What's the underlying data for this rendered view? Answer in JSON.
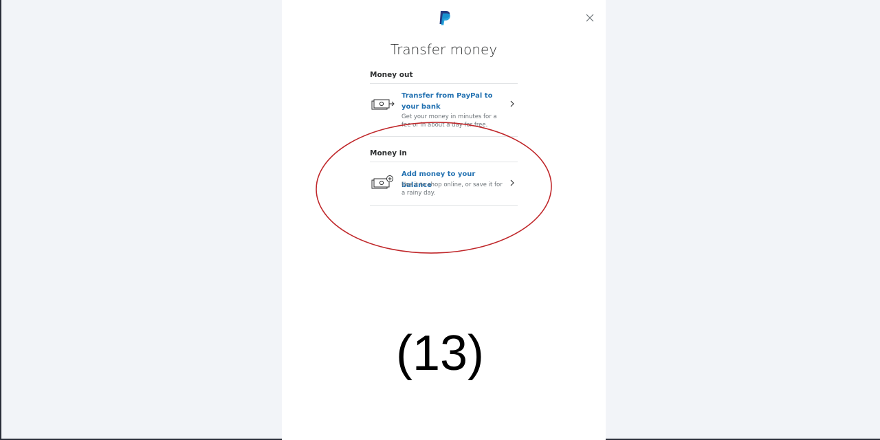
{
  "modal": {
    "title": "Transfer money",
    "logo_icon": "paypal-logo",
    "close_icon": "close-icon"
  },
  "money_out": {
    "label": "Money out",
    "option": {
      "icon": "bank-transfer-icon",
      "title": "Transfer from PayPal to your bank",
      "description": "Get your money in minutes for a fee or in about a day for free."
    }
  },
  "money_in": {
    "label": "Money in",
    "option": {
      "icon": "add-money-icon",
      "title": "Add money to your balance",
      "description": "Use it to shop online, or save it for a rainy day."
    }
  },
  "annotation": {
    "label": "(13)",
    "circle_color": "#c0282b"
  },
  "colors": {
    "link_blue": "#2271b1",
    "paypal_dark": "#253b80",
    "paypal_light": "#179bd7",
    "background": "#f2f4f8"
  }
}
